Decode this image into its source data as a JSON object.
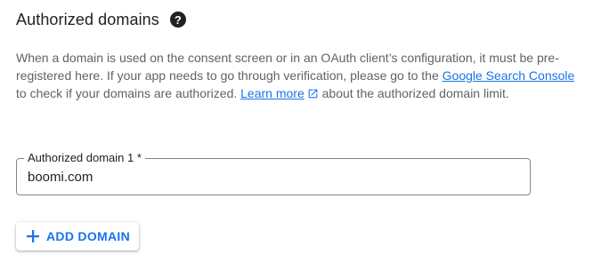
{
  "section": {
    "title": "Authorized domains",
    "help_icon": "help-circle-icon",
    "description": {
      "part1": "When a domain is used on the consent screen or in an OAuth client’s configuration, it must be pre-registered here. If your app needs to go through verification, please go to the ",
      "link1": "Google Search Console",
      "part2": " to check if your domains are authorized. ",
      "link2": "Learn more",
      "link2_icon": "open-in-new-icon",
      "part3": " about the authorized domain limit."
    }
  },
  "field": {
    "label": "Authorized domain 1 *",
    "value": "boomi.com"
  },
  "add_button": {
    "icon": "plus-icon",
    "label": "ADD DOMAIN"
  },
  "colors": {
    "link": "#1a73e8",
    "text": "#202124",
    "secondary_text": "#5f6368",
    "border": "#80868b"
  }
}
